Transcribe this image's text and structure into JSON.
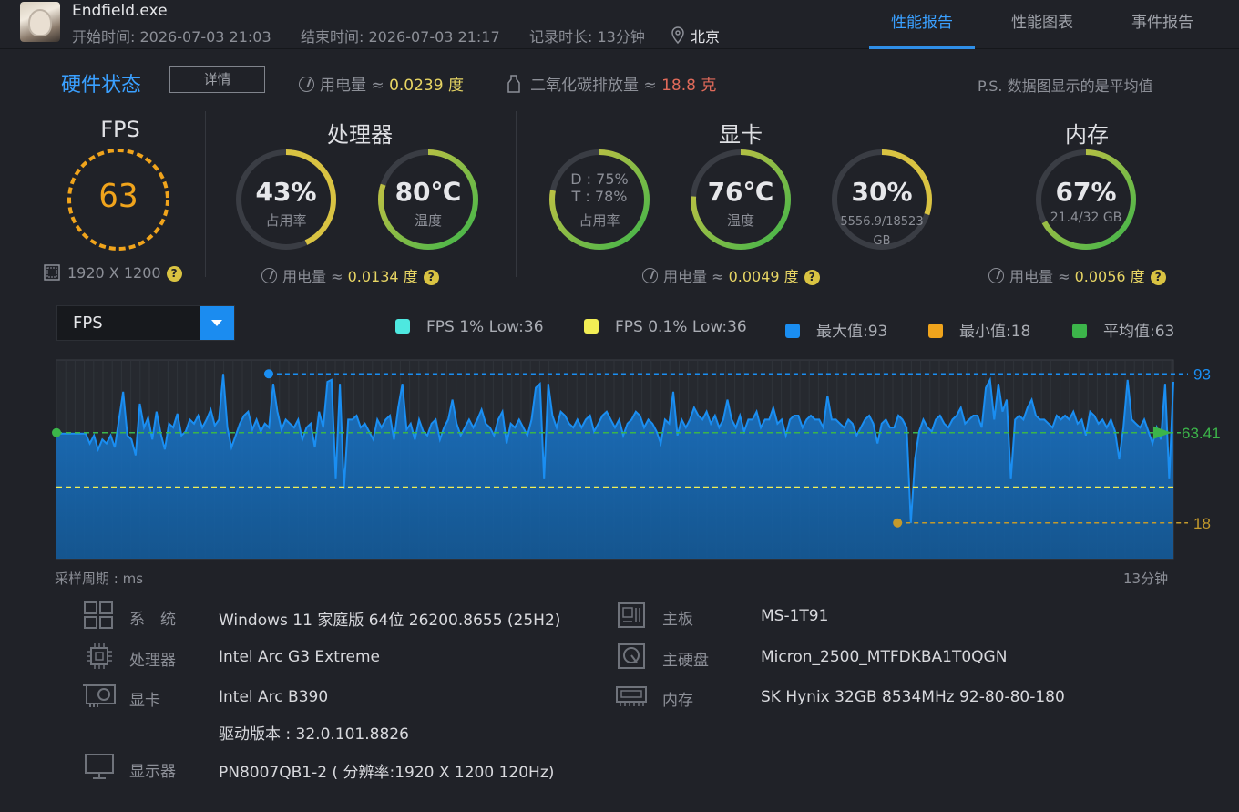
{
  "header": {
    "app_name": "Endfield.exe",
    "start_time": "开始时间: 2026-07-03 21:03",
    "end_time": "结束时间: 2026-07-03 21:17",
    "duration": "记录时长: 13分钟",
    "location": "北京",
    "tabs": [
      {
        "label": "性能报告",
        "active": true
      },
      {
        "label": "性能图表",
        "active": false
      },
      {
        "label": "事件报告",
        "active": false
      }
    ]
  },
  "hardware": {
    "title": "硬件状态",
    "detail_button": "详情",
    "power_label": "用电量 ≈ ",
    "power_value": "0.0239 度",
    "co2_label": "二氧化碳排放量 ≈ ",
    "co2_value": "18.8 克",
    "ps_note": "P.S. 数据图显示的是平均值"
  },
  "fps": {
    "title": "FPS",
    "value": "63",
    "resolution": "1920 X 1200"
  },
  "cpu": {
    "title": "处理器",
    "usage": {
      "value": "43%",
      "label": "占用率",
      "fraction": 0.43
    },
    "temp": {
      "value": "80℃",
      "label": "温度",
      "fraction": 0.8
    },
    "power_label": "用电量 ≈ ",
    "power_value": "0.0134 度"
  },
  "gpu": {
    "title": "显卡",
    "usage": {
      "line1": "D : 75%",
      "line2": "T : 78%",
      "label": "占用率",
      "fraction": 0.78
    },
    "temp": {
      "value": "76℃",
      "label": "温度",
      "fraction": 0.76
    },
    "vram": {
      "value": "30%",
      "label": "5556.9/18523 GB",
      "fraction": 0.3
    },
    "power_label": "用电量 ≈ ",
    "power_value": "0.0049 度"
  },
  "memory": {
    "title": "内存",
    "usage": {
      "value": "67%",
      "label": "21.4/32 GB",
      "fraction": 0.67
    },
    "power_label": "用电量 ≈ ",
    "power_value": "0.0056 度"
  },
  "chart_controls": {
    "selected_metric": "FPS",
    "legend": [
      {
        "label": "FPS 1% Low:36",
        "color": "#4ee8e0"
      },
      {
        "label": "FPS 0.1% Low:36",
        "color": "#f2ee55"
      },
      {
        "label": "最大值:93",
        "color": "#1a8ef2"
      },
      {
        "label": "最小值:18",
        "color": "#f0a41c"
      },
      {
        "label": "平均值:63",
        "color": "#3cb54a"
      }
    ],
    "footer_left": "采样周期 : ms",
    "footer_right": "13分钟"
  },
  "chart_data": {
    "type": "area",
    "title": "",
    "xlabel": "",
    "ylabel": "",
    "x_range": [
      "0",
      "13分钟"
    ],
    "ylim": [
      0,
      100
    ],
    "max": 93,
    "min": 18,
    "average": 63.41,
    "low_1pct": 36,
    "low_01pct": 36,
    "max_label": "93",
    "avg_label": "63.41",
    "min_label": "18",
    "max_at_fraction": 0.19,
    "min_at_fraction": 0.753,
    "series": [
      {
        "values": [
          63,
          63,
          63,
          63,
          63,
          63,
          63,
          63,
          58,
          62,
          55,
          60,
          58,
          62,
          56,
          70,
          84,
          62,
          60,
          52,
          78,
          66,
          71,
          60,
          74,
          63,
          55,
          68,
          66,
          73,
          62,
          64,
          70,
          68,
          72,
          66,
          70,
          75,
          67,
          70,
          93,
          66,
          56,
          62,
          68,
          72,
          74,
          65,
          70,
          64,
          68,
          66,
          88,
          74,
          65,
          70,
          68,
          66,
          70,
          60,
          66,
          68,
          56,
          74,
          66,
          89,
          90,
          40,
          88,
          35,
          70,
          70,
          72,
          66,
          68,
          64,
          60,
          70,
          66,
          70,
          72,
          60,
          76,
          88,
          65,
          68,
          60,
          70,
          64,
          62,
          68,
          70,
          60,
          66,
          70,
          80,
          68,
          62,
          66,
          70,
          66,
          70,
          75,
          68,
          66,
          62,
          70,
          74,
          58,
          68,
          66,
          70,
          66,
          62,
          70,
          86,
          88,
          40,
          88,
          72,
          66,
          74,
          72,
          68,
          66,
          70,
          66,
          70,
          72,
          64,
          68,
          72,
          74,
          70,
          66,
          70,
          62,
          68,
          70,
          74,
          72,
          66,
          70,
          68,
          64,
          58,
          70,
          68,
          84,
          62,
          70,
          66,
          70,
          76,
          72,
          70,
          74,
          68,
          72,
          66,
          70,
          80,
          70,
          66,
          72,
          64,
          70,
          70,
          74,
          66,
          70,
          70,
          76,
          68,
          70,
          62,
          70,
          72,
          72,
          66,
          70,
          72,
          70,
          70,
          66,
          82,
          70,
          70,
          68,
          66,
          70,
          68,
          62,
          66,
          70,
          72,
          68,
          58,
          68,
          70,
          66,
          66,
          72,
          70,
          66,
          18,
          50,
          64,
          70,
          66,
          64,
          70,
          72,
          68,
          66,
          70,
          72,
          76,
          68,
          70,
          72,
          72,
          66,
          86,
          90,
          70,
          88,
          74,
          80,
          40,
          70,
          72,
          70,
          76,
          80,
          72,
          70,
          70,
          68,
          66,
          72,
          70,
          72,
          70,
          74,
          68,
          70,
          62,
          74,
          72,
          68,
          70,
          66,
          70,
          64,
          50,
          66,
          90,
          70,
          68,
          66,
          70,
          64,
          58,
          66,
          60,
          88,
          40,
          89
        ]
      }
    ]
  },
  "system_info": {
    "left": [
      {
        "icon": "windows-icon",
        "label": "系　统",
        "value": "Windows 11 家庭版 64位 26200.8655 (25H2)"
      },
      {
        "icon": "cpu-icon",
        "label": "处理器",
        "value": "Intel Arc G3 Extreme"
      },
      {
        "icon": "gpu-icon",
        "label": "显卡",
        "value": "Intel Arc B390",
        "value2": "驱动版本 : 32.0.101.8826"
      },
      {
        "icon": "monitor-icon",
        "label": "显示器",
        "value": "PN8007QB1-2 ( 分辨率:1920 X 1200 120Hz)"
      }
    ],
    "right": [
      {
        "icon": "motherboard-icon",
        "label": "主板",
        "value": "MS-1T91"
      },
      {
        "icon": "disk-icon",
        "label": "主硬盘",
        "value": "Micron_2500_MTFDKBA1T0QGN"
      },
      {
        "icon": "ram-icon",
        "label": "内存",
        "value": "SK Hynix 32GB 8534MHz 92-80-80-180"
      }
    ]
  },
  "colors": {
    "accent": "#3aa0ff",
    "gauge_track": "#3a3d44",
    "gauge_green": "#3cb54a",
    "gauge_yellow": "#d9c342",
    "fps_ring": "#f0a41c",
    "chart_line": "#1a8ef2"
  }
}
